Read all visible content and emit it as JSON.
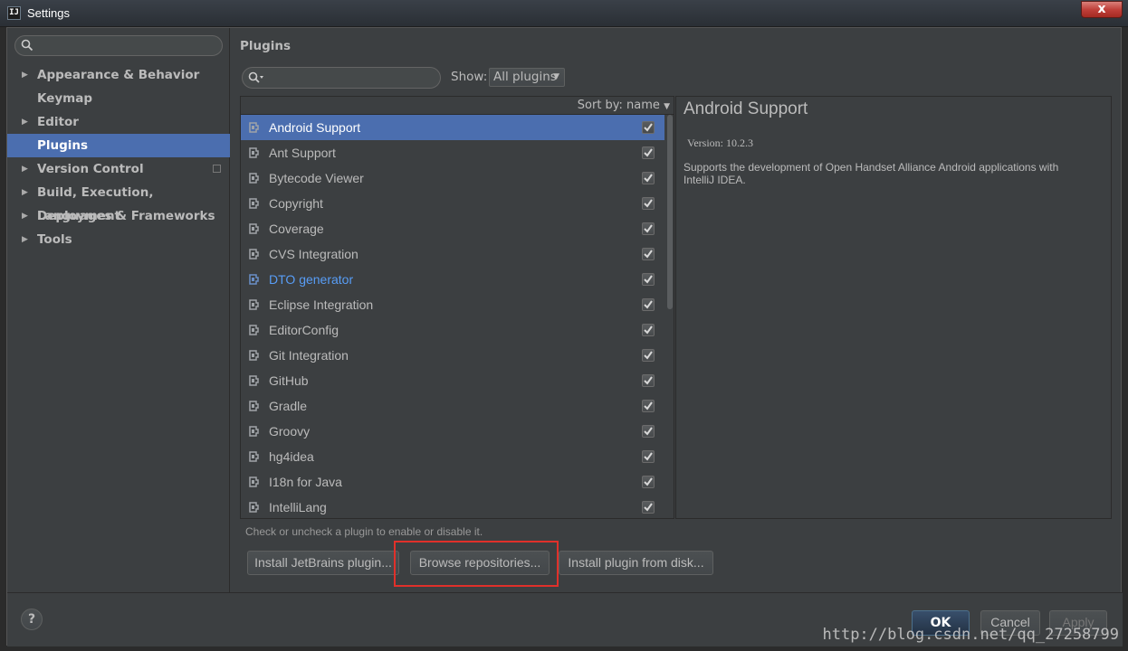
{
  "window": {
    "title": "Settings",
    "app_icon_text": "IJ",
    "close_label": "x"
  },
  "sidebar": {
    "search_placeholder": "",
    "items": [
      {
        "label": "Appearance & Behavior",
        "expandable": true,
        "selected": false
      },
      {
        "label": "Keymap",
        "expandable": false,
        "selected": false
      },
      {
        "label": "Editor",
        "expandable": true,
        "selected": false
      },
      {
        "label": "Plugins",
        "expandable": false,
        "selected": true
      },
      {
        "label": "Version Control",
        "expandable": true,
        "selected": false
      },
      {
        "label": "Build, Execution, Deployment",
        "expandable": true,
        "selected": false
      },
      {
        "label": "Languages & Frameworks",
        "expandable": true,
        "selected": false
      },
      {
        "label": "Tools",
        "expandable": true,
        "selected": false
      }
    ]
  },
  "main": {
    "title": "Plugins",
    "search_placeholder": "",
    "show_label": "Show:",
    "show_value": "All plugins",
    "sort_label": "Sort by: name",
    "plugins": [
      {
        "name": "Android Support",
        "checked": true,
        "selected": true,
        "highlighted": false
      },
      {
        "name": "Ant Support",
        "checked": true,
        "selected": false,
        "highlighted": false
      },
      {
        "name": "Bytecode Viewer",
        "checked": true,
        "selected": false,
        "highlighted": false
      },
      {
        "name": "Copyright",
        "checked": true,
        "selected": false,
        "highlighted": false
      },
      {
        "name": "Coverage",
        "checked": true,
        "selected": false,
        "highlighted": false
      },
      {
        "name": "CVS Integration",
        "checked": true,
        "selected": false,
        "highlighted": false
      },
      {
        "name": "DTO generator",
        "checked": true,
        "selected": false,
        "highlighted": true
      },
      {
        "name": "Eclipse Integration",
        "checked": true,
        "selected": false,
        "highlighted": false
      },
      {
        "name": "EditorConfig",
        "checked": true,
        "selected": false,
        "highlighted": false
      },
      {
        "name": "Git Integration",
        "checked": true,
        "selected": false,
        "highlighted": false
      },
      {
        "name": "GitHub",
        "checked": true,
        "selected": false,
        "highlighted": false
      },
      {
        "name": "Gradle",
        "checked": true,
        "selected": false,
        "highlighted": false
      },
      {
        "name": "Groovy",
        "checked": true,
        "selected": false,
        "highlighted": false
      },
      {
        "name": "hg4idea",
        "checked": true,
        "selected": false,
        "highlighted": false
      },
      {
        "name": "I18n for Java",
        "checked": true,
        "selected": false,
        "highlighted": false
      },
      {
        "name": "IntelliLang",
        "checked": true,
        "selected": false,
        "highlighted": false
      }
    ],
    "details": {
      "title": "Android Support",
      "version": "Version: 10.2.3",
      "description": "Supports the development of Open Handset Alliance Android applications with IntelliJ IDEA."
    },
    "hint": "Check or uncheck a plugin to enable or disable it.",
    "buttons": {
      "install_jetbrains": "Install JetBrains plugin...",
      "browse_repos": "Browse repositories...",
      "install_disk": "Install plugin from disk..."
    }
  },
  "footer": {
    "help": "?",
    "ok": "OK",
    "cancel": "Cancel",
    "apply": "Apply",
    "watermark": "http://blog.csdn.net/qq_27258799"
  },
  "colors": {
    "selection": "#4b6eaf",
    "background": "#3c3f41",
    "highlight_box": "#e0302a",
    "link": "#589df6"
  }
}
